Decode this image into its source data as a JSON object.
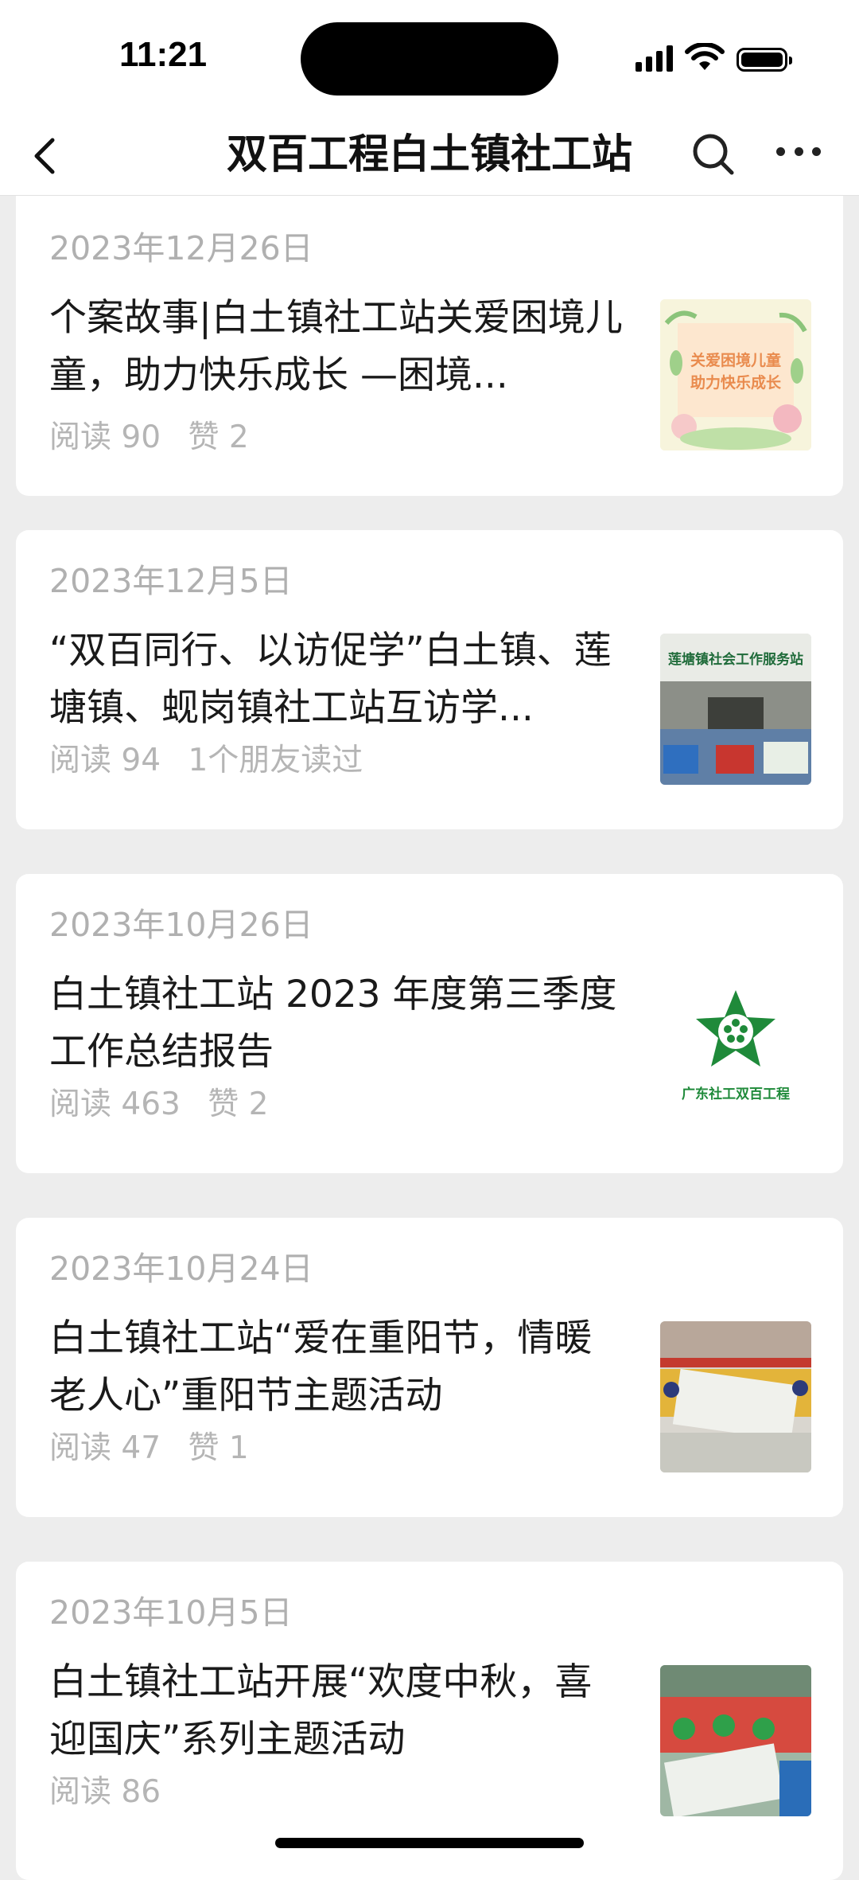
{
  "status_bar": {
    "time": "11:21"
  },
  "nav": {
    "title": "双百工程白土镇社工站"
  },
  "articles": [
    {
      "date": "2023年12月26日",
      "title": "个案故事|白土镇社工站关爱困境儿童，助力快乐成长 —困境...",
      "reads": "阅读 90",
      "extra": "赞 2",
      "thumb_text": [
        "关爱困境儿童",
        "助力快乐成长"
      ]
    },
    {
      "date": "2023年12月5日",
      "title": "“双百同行、以访促学”白土镇、莲塘镇、蚬岗镇社工站互访学...",
      "reads": "阅读 94",
      "extra": "1个朋友读过",
      "thumb_text": [
        "莲塘镇社会工作服务站"
      ]
    },
    {
      "date": "2023年10月26日",
      "title": "白土镇社工站 2023 年度第三季度工作总结报告",
      "reads": "阅读 463",
      "extra": "赞 2",
      "thumb_text": [
        "广东社工双百工程"
      ]
    },
    {
      "date": "2023年10月24日",
      "title": "白土镇社工站“爱在重阳节，情暖老人心”重阳节主题活动",
      "reads": "阅读 47",
      "extra": "赞 1",
      "thumb_text": []
    },
    {
      "date": "2023年10月5日",
      "title": "白土镇社工站开展“欢度中秋，喜迎国庆”系列主题活动",
      "reads": "阅读 86",
      "extra": "",
      "thumb_text": []
    }
  ],
  "colors": {
    "background": "#ededed",
    "card": "#ffffff",
    "muted_text": "#b0b0b0",
    "logo_green": "#1f8a3a"
  }
}
